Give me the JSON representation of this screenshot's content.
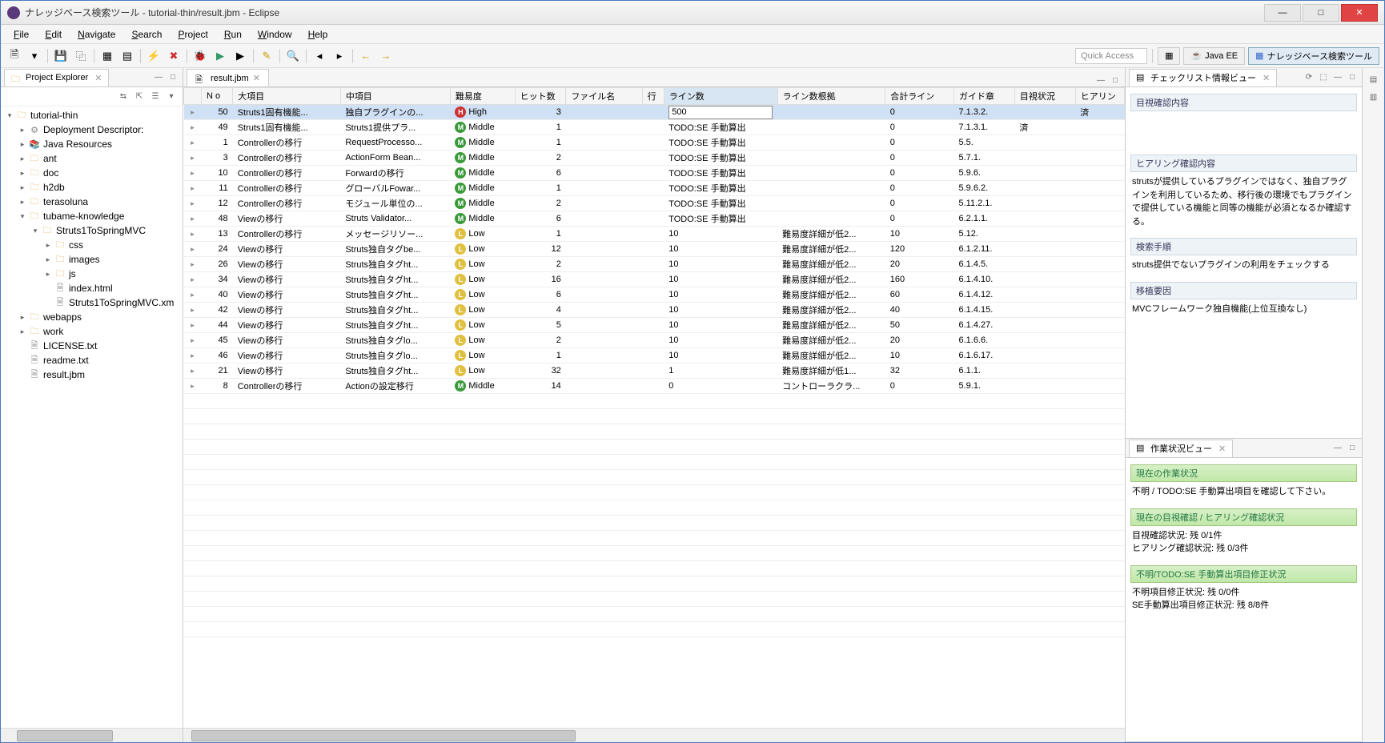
{
  "window": {
    "title": "ナレッジベース検索ツール - tutorial-thin/result.jbm - Eclipse"
  },
  "menu": [
    "File",
    "Edit",
    "Navigate",
    "Search",
    "Project",
    "Run",
    "Window",
    "Help"
  ],
  "quick_access": "Quick Access",
  "perspectives": {
    "javaee": "Java EE",
    "kb": "ナレッジベース検索ツール"
  },
  "explorer": {
    "title": "Project Explorer",
    "tree": [
      {
        "d": 0,
        "exp": "▾",
        "icon": "project",
        "label": "tutorial-thin"
      },
      {
        "d": 1,
        "exp": "▸",
        "icon": "dd",
        "label": "Deployment Descriptor: <web"
      },
      {
        "d": 1,
        "exp": "▸",
        "icon": "jar",
        "label": "Java Resources"
      },
      {
        "d": 1,
        "exp": "▸",
        "icon": "folder",
        "label": "ant"
      },
      {
        "d": 1,
        "exp": "▸",
        "icon": "folder",
        "label": "doc"
      },
      {
        "d": 1,
        "exp": "▸",
        "icon": "folder",
        "label": "h2db"
      },
      {
        "d": 1,
        "exp": "▸",
        "icon": "folder",
        "label": "terasoluna"
      },
      {
        "d": 1,
        "exp": "▾",
        "icon": "folder",
        "label": "tubame-knowledge"
      },
      {
        "d": 2,
        "exp": "▾",
        "icon": "folder",
        "label": "Struts1ToSpringMVC"
      },
      {
        "d": 3,
        "exp": "▸",
        "icon": "folder",
        "label": "css"
      },
      {
        "d": 3,
        "exp": "▸",
        "icon": "folder",
        "label": "images"
      },
      {
        "d": 3,
        "exp": "▸",
        "icon": "folder",
        "label": "js"
      },
      {
        "d": 3,
        "exp": "",
        "icon": "file",
        "label": "index.html"
      },
      {
        "d": 3,
        "exp": "",
        "icon": "file",
        "label": "Struts1ToSpringMVC.xm"
      },
      {
        "d": 1,
        "exp": "▸",
        "icon": "folder",
        "label": "webapps"
      },
      {
        "d": 1,
        "exp": "▸",
        "icon": "folder",
        "label": "work"
      },
      {
        "d": 1,
        "exp": "",
        "icon": "file",
        "label": "LICENSE.txt"
      },
      {
        "d": 1,
        "exp": "",
        "icon": "file",
        "label": "readme.txt"
      },
      {
        "d": 1,
        "exp": "",
        "icon": "file",
        "label": "result.jbm"
      }
    ]
  },
  "editor": {
    "tab": "result.jbm",
    "columns": [
      "",
      "N o",
      "大項目",
      "中項目",
      "難易度",
      "ヒット数",
      "ファイル名",
      "行",
      "ライン数",
      "ライン数根拠",
      "合計ライン",
      "ガイド章",
      "目視状況",
      "ヒアリン"
    ],
    "rows": [
      {
        "no": "50",
        "big": "Struts1固有機能...",
        "mid": "独自プラグインの...",
        "diff": "High",
        "hits": "3",
        "file": "",
        "line": "",
        "lines": "500",
        "basis": "",
        "total": "0",
        "guide": "7.1.3.2.",
        "vis": "",
        "hear": "済",
        "sel": true,
        "editing": true
      },
      {
        "no": "49",
        "big": "Struts1固有機能...",
        "mid": "Struts1提供プラ...",
        "diff": "Middle",
        "hits": "1",
        "file": "",
        "line": "",
        "lines": "TODO:SE 手動算出",
        "basis": "",
        "total": "0",
        "guide": "7.1.3.1.",
        "vis": "済",
        "hear": ""
      },
      {
        "no": "1",
        "big": "Controllerの移行",
        "mid": "RequestProcesso...",
        "diff": "Middle",
        "hits": "1",
        "file": "",
        "line": "",
        "lines": "TODO:SE 手動算出",
        "basis": "",
        "total": "0",
        "guide": "5.5.",
        "vis": "",
        "hear": ""
      },
      {
        "no": "3",
        "big": "Controllerの移行",
        "mid": "ActionForm Bean...",
        "diff": "Middle",
        "hits": "2",
        "file": "",
        "line": "",
        "lines": "TODO:SE 手動算出",
        "basis": "",
        "total": "0",
        "guide": "5.7.1.",
        "vis": "",
        "hear": ""
      },
      {
        "no": "10",
        "big": "Controllerの移行",
        "mid": "Forwardの移行",
        "diff": "Middle",
        "hits": "6",
        "file": "",
        "line": "",
        "lines": "TODO:SE 手動算出",
        "basis": "",
        "total": "0",
        "guide": "5.9.6.",
        "vis": "",
        "hear": ""
      },
      {
        "no": "11",
        "big": "Controllerの移行",
        "mid": "グローバルFowar...",
        "diff": "Middle",
        "hits": "1",
        "file": "",
        "line": "",
        "lines": "TODO:SE 手動算出",
        "basis": "",
        "total": "0",
        "guide": "5.9.6.2.",
        "vis": "",
        "hear": ""
      },
      {
        "no": "12",
        "big": "Controllerの移行",
        "mid": "モジュール単位の...",
        "diff": "Middle",
        "hits": "2",
        "file": "",
        "line": "",
        "lines": "TODO:SE 手動算出",
        "basis": "",
        "total": "0",
        "guide": "5.11.2.1.",
        "vis": "",
        "hear": ""
      },
      {
        "no": "48",
        "big": "Viewの移行",
        "mid": "Struts Validator...",
        "diff": "Middle",
        "hits": "6",
        "file": "",
        "line": "",
        "lines": "TODO:SE 手動算出",
        "basis": "",
        "total": "0",
        "guide": "6.2.1.1.",
        "vis": "",
        "hear": ""
      },
      {
        "no": "13",
        "big": "Controllerの移行",
        "mid": "メッセージリソー...",
        "diff": "Low",
        "hits": "1",
        "file": "",
        "line": "",
        "lines": "10",
        "basis": "難易度詳細が低2...",
        "total": "10",
        "guide": "5.12.",
        "vis": "",
        "hear": ""
      },
      {
        "no": "24",
        "big": "Viewの移行",
        "mid": "Struts独自タグbe...",
        "diff": "Low",
        "hits": "12",
        "file": "",
        "line": "",
        "lines": "10",
        "basis": "難易度詳細が低2...",
        "total": "120",
        "guide": "6.1.2.11.",
        "vis": "",
        "hear": ""
      },
      {
        "no": "26",
        "big": "Viewの移行",
        "mid": "Struts独自タグht...",
        "diff": "Low",
        "hits": "2",
        "file": "",
        "line": "",
        "lines": "10",
        "basis": "難易度詳細が低2...",
        "total": "20",
        "guide": "6.1.4.5.",
        "vis": "",
        "hear": ""
      },
      {
        "no": "34",
        "big": "Viewの移行",
        "mid": "Struts独自タグht...",
        "diff": "Low",
        "hits": "16",
        "file": "",
        "line": "",
        "lines": "10",
        "basis": "難易度詳細が低2...",
        "total": "160",
        "guide": "6.1.4.10.",
        "vis": "",
        "hear": ""
      },
      {
        "no": "40",
        "big": "Viewの移行",
        "mid": "Struts独自タグht...",
        "diff": "Low",
        "hits": "6",
        "file": "",
        "line": "",
        "lines": "10",
        "basis": "難易度詳細が低2...",
        "total": "60",
        "guide": "6.1.4.12.",
        "vis": "",
        "hear": ""
      },
      {
        "no": "42",
        "big": "Viewの移行",
        "mid": "Struts独自タグht...",
        "diff": "Low",
        "hits": "4",
        "file": "",
        "line": "",
        "lines": "10",
        "basis": "難易度詳細が低2...",
        "total": "40",
        "guide": "6.1.4.15.",
        "vis": "",
        "hear": ""
      },
      {
        "no": "44",
        "big": "Viewの移行",
        "mid": "Struts独自タグht...",
        "diff": "Low",
        "hits": "5",
        "file": "",
        "line": "",
        "lines": "10",
        "basis": "難易度詳細が低2...",
        "total": "50",
        "guide": "6.1.4.27.",
        "vis": "",
        "hear": ""
      },
      {
        "no": "45",
        "big": "Viewの移行",
        "mid": "Struts独自タグlo...",
        "diff": "Low",
        "hits": "2",
        "file": "",
        "line": "",
        "lines": "10",
        "basis": "難易度詳細が低2...",
        "total": "20",
        "guide": "6.1.6.6.",
        "vis": "",
        "hear": ""
      },
      {
        "no": "46",
        "big": "Viewの移行",
        "mid": "Struts独自タグlo...",
        "diff": "Low",
        "hits": "1",
        "file": "",
        "line": "",
        "lines": "10",
        "basis": "難易度詳細が低2...",
        "total": "10",
        "guide": "6.1.6.17.",
        "vis": "",
        "hear": ""
      },
      {
        "no": "21",
        "big": "Viewの移行",
        "mid": "Struts独自タグht...",
        "diff": "Low",
        "hits": "32",
        "file": "",
        "line": "",
        "lines": "1",
        "basis": "難易度詳細が低1...",
        "total": "32",
        "guide": "6.1.1.",
        "vis": "",
        "hear": ""
      },
      {
        "no": "8",
        "big": "Controllerの移行",
        "mid": "Actionの設定移行",
        "diff": "Middle",
        "hits": "14",
        "file": "",
        "line": "",
        "lines": "0",
        "basis": "コントローラクラ...",
        "total": "0",
        "guide": "5.9.1.",
        "vis": "",
        "hear": ""
      }
    ]
  },
  "check_view": {
    "title": "チェックリスト情報ビュー",
    "sections": {
      "visual": {
        "header": "目視確認内容",
        "body": ""
      },
      "hearing": {
        "header": "ヒアリング確認内容",
        "body": "strutsが提供しているプラグインではなく、独自プラグインを利用しているため、移行後の環境でもプラグインで提供している機能と同等の機能が必須となるか確認する。"
      },
      "search": {
        "header": "検索手順",
        "body": "struts提供でないプラグインの利用をチェックする"
      },
      "factor": {
        "header": "移植要因",
        "body": "MVCフレームワーク独自機能(上位互換なし)"
      }
    }
  },
  "work_view": {
    "title": "作業状況ビュー",
    "sections": {
      "current": {
        "header": "現在の作業状況",
        "body": "不明 / TODO:SE 手動算出項目を確認して下さい。"
      },
      "confirm": {
        "header": "現在の目視確認 / ヒアリング確認状況",
        "body1": "目視確認状況: 残 0/1件",
        "body2": "ヒアリング確認状況: 残 0/3件"
      },
      "todo": {
        "header": "不明/TODO:SE 手動算出項目修正状況",
        "body1": "不明項目修正状況: 残 0/0件",
        "body2": "SE手動算出項目修正状況: 残 8/8件"
      }
    }
  }
}
